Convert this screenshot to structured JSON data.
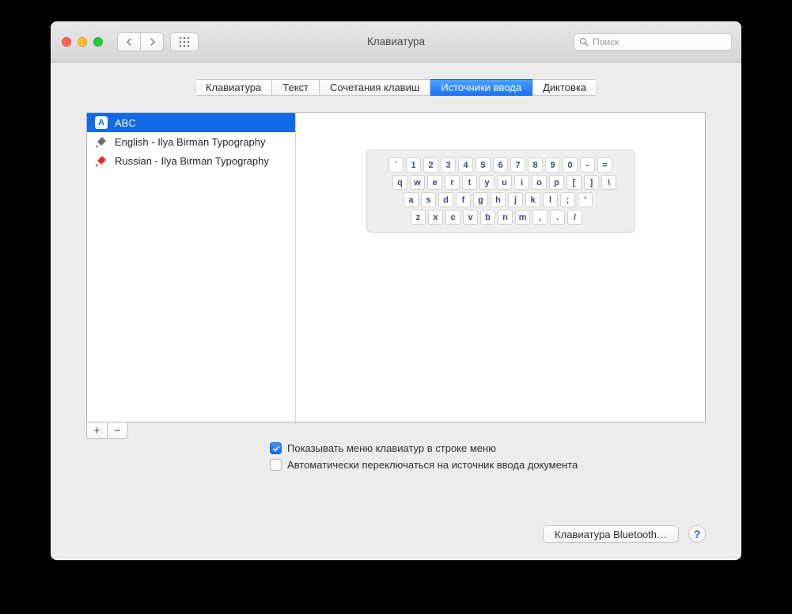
{
  "window": {
    "title": "Клавиатура"
  },
  "search": {
    "placeholder": "Поиск"
  },
  "tabs": [
    {
      "label": "Клавиатура",
      "active": false
    },
    {
      "label": "Текст",
      "active": false
    },
    {
      "label": "Сочетания клавиш",
      "active": false
    },
    {
      "label": "Источники ввода",
      "active": true
    },
    {
      "label": "Диктовка",
      "active": false
    }
  ],
  "sources": [
    {
      "label": "ABC",
      "icon": "abc",
      "selected": true
    },
    {
      "label": "English - Ilya Birman Typography",
      "icon": "pin-gray",
      "selected": false
    },
    {
      "label": "Russian - Ilya Birman Typography",
      "icon": "pin-red",
      "selected": false
    }
  ],
  "keyboard_rows": [
    [
      "`",
      "1",
      "2",
      "3",
      "4",
      "5",
      "6",
      "7",
      "8",
      "9",
      "0",
      "-",
      "="
    ],
    [
      "q",
      "w",
      "e",
      "r",
      "t",
      "y",
      "u",
      "i",
      "o",
      "p",
      "[",
      "]",
      "\\"
    ],
    [
      "a",
      "s",
      "d",
      "f",
      "g",
      "h",
      "j",
      "k",
      "l",
      ";",
      "'"
    ],
    [
      "z",
      "x",
      "c",
      "v",
      "b",
      "n",
      "m",
      ",",
      ".",
      "/"
    ]
  ],
  "checkboxes": {
    "show_menu": {
      "label": "Показывать меню клавиатур в строке меню",
      "checked": true
    },
    "auto_switch": {
      "label": "Автоматически переключаться на источник ввода документа",
      "checked": false
    }
  },
  "footer": {
    "bluetooth_label": "Клавиатура Bluetooth…",
    "help_label": "?"
  },
  "plus": "+",
  "minus": "−"
}
